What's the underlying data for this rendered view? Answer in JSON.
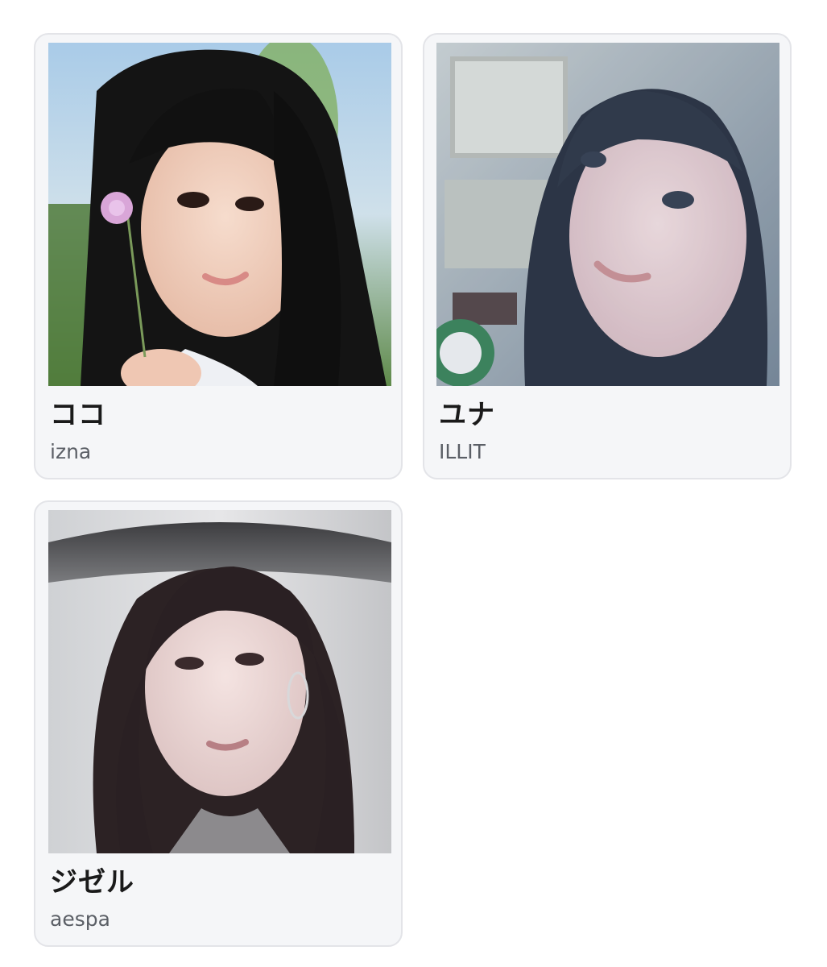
{
  "cards": [
    {
      "name": "ココ",
      "group": "izna"
    },
    {
      "name": "ユナ",
      "group": "ILLIT"
    },
    {
      "name": "ジゼル",
      "group": "aespa"
    }
  ]
}
